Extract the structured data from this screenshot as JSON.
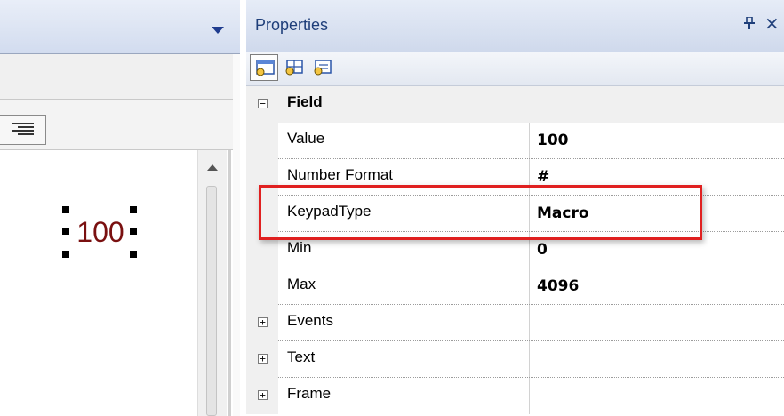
{
  "left_pane": {
    "field_value": "100"
  },
  "properties": {
    "title": "Properties",
    "pin_glyph": "ᵾ",
    "close_glyph": "×",
    "toolbar": [
      {
        "icon": "categorized-view-icon",
        "active": true
      },
      {
        "icon": "add-property-icon",
        "active": false
      },
      {
        "icon": "alphabetical-view-icon",
        "active": false
      }
    ],
    "field_category": {
      "label": "Field",
      "toggle": "−"
    },
    "rows": [
      {
        "name": "Value",
        "value": "100"
      },
      {
        "name": "Number Format",
        "value": "#"
      },
      {
        "name": "KeypadType",
        "value": "Macro"
      },
      {
        "name": "Min",
        "value": "0"
      },
      {
        "name": "Max",
        "value": "4096"
      }
    ],
    "collapsed_categories": [
      {
        "label": "Events",
        "toggle": "+"
      },
      {
        "label": "Text",
        "toggle": "+"
      },
      {
        "label": "Frame",
        "toggle": "+"
      }
    ],
    "highlighted_row": "KeypadType",
    "highlight_color": "#e02020"
  }
}
